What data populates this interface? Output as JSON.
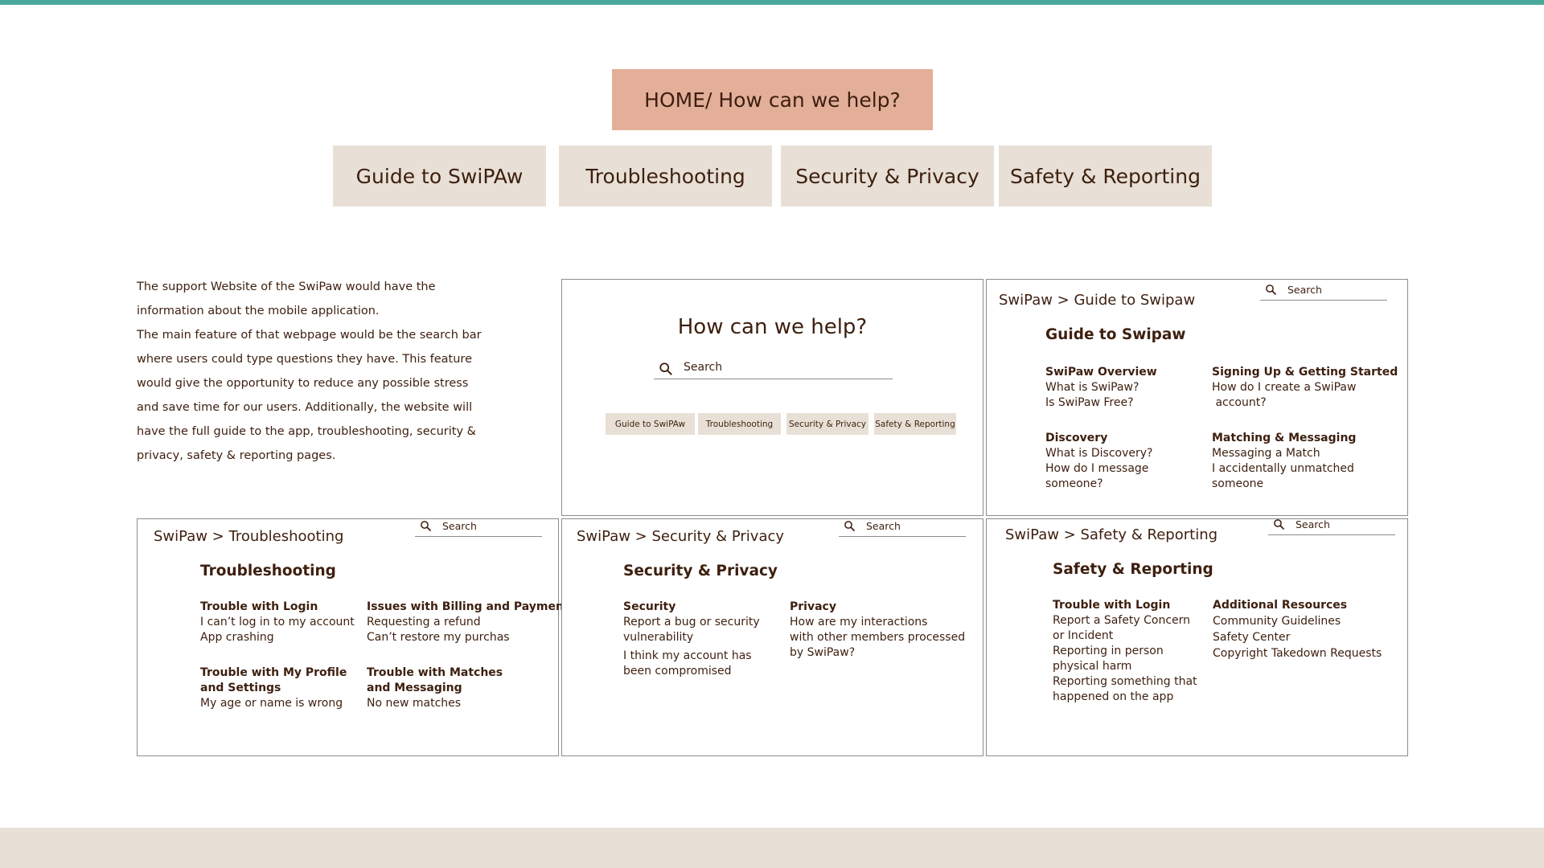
{
  "hero": {
    "label": "HOME/ How can we help?"
  },
  "nav": [
    {
      "label": "Guide to SwiPAw"
    },
    {
      "label": "Troubleshooting"
    },
    {
      "label": "Security & Privacy"
    },
    {
      "label": "Safety & Reporting"
    }
  ],
  "description": {
    "lines": [
      "The support Website of the SwiPaw would have the",
      "information about the mobile application.",
      "The main feature of that webpage would be the search bar",
      "where users could type questions they have. This feature",
      "would give the opportunity to reduce any possible stress",
      "and save time for our users. Additionally, the website will",
      "have the full guide to the app, troubleshooting, security &",
      "privacy, safety & reporting pages."
    ]
  },
  "search_placeholder": "Search",
  "help_panel": {
    "title": "How can we help?",
    "search_placeholder": "Search",
    "tabs": [
      "Guide to SwiPAw",
      "Troubleshooting",
      "Security & Privacy",
      "Safety & Reporting"
    ]
  },
  "guide_panel": {
    "breadcrumb": "SwiPaw > Guide to Swipaw",
    "search_placeholder": "Search",
    "title": "Guide to Swipaw",
    "sections": [
      {
        "heading": "SwiPaw Overview",
        "items": [
          "What is SwiPaw?",
          "Is SwiPaw Free?"
        ]
      },
      {
        "heading": "Signing Up & Getting Started",
        "items": [
          "How do I create a SwiPaw",
          " account?"
        ]
      },
      {
        "heading": "Discovery",
        "items": [
          "What is Discovery?",
          "How do I message",
          "someone?"
        ]
      },
      {
        "heading": "Matching & Messaging",
        "items": [
          "Messaging a Match",
          "I accidentally unmatched",
          "someone"
        ]
      }
    ]
  },
  "troubleshooting_panel": {
    "breadcrumb": "SwiPaw > Troubleshooting",
    "search_placeholder": "Search",
    "title": "Troubleshooting",
    "sections": [
      {
        "heading": "Trouble with Login",
        "items": [
          "I can’t log in to my account",
          "App crashing"
        ]
      },
      {
        "heading": "Issues with Billing and Payment",
        "items": [
          "Requesting a refund",
          "Can’t restore my purchas"
        ]
      },
      {
        "heading_lines": [
          "Trouble with My Profile",
          "and Settings"
        ],
        "items": [
          "My age or name is wrong"
        ]
      },
      {
        "heading_lines": [
          "Trouble with Matches",
          "and Messaging"
        ],
        "items": [
          "No new matches"
        ]
      }
    ]
  },
  "security_panel": {
    "breadcrumb": "SwiPaw > Security & Privacy",
    "search_placeholder": "Search",
    "title": "Security & Privacy",
    "sections": [
      {
        "heading": "Security",
        "items": [
          "Report a bug or security",
          "vulnerability",
          "I think my account has",
          "been compromised"
        ]
      },
      {
        "heading": "Privacy",
        "items": [
          "How are my interactions",
          "with other members processed",
          "by SwiPaw?"
        ]
      }
    ]
  },
  "safety_panel": {
    "breadcrumb": "SwiPaw > Safety & Reporting",
    "search_placeholder": "Search",
    "title": "Safety & Reporting",
    "sections": [
      {
        "heading": "Trouble with Login",
        "items": [
          "Report a Safety Concern",
          "or Incident",
          "Reporting in person",
          "physical harm",
          "Reporting something that",
          "happened on the app"
        ]
      },
      {
        "heading": "Additional Resources",
        "items": [
          "Community Guidelines",
          "Safety Center",
          "Copyright Takedown Requests"
        ]
      }
    ]
  },
  "colors": {
    "accent_strip": "#4aa79c",
    "hero_bg": "#e3af99",
    "tab_bg": "#e8e0d6",
    "text": "#3d1f0f"
  },
  "icons": {
    "search": "magnifier-icon"
  }
}
